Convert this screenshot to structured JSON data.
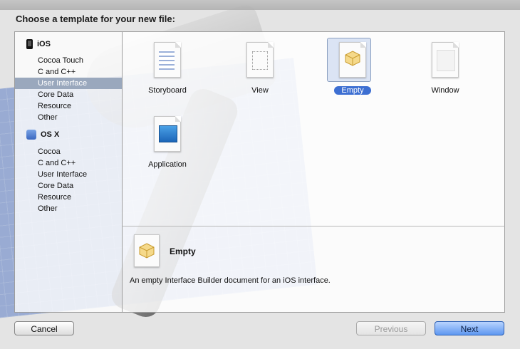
{
  "dialog": {
    "title": "Choose a template for your new file:"
  },
  "sidebar": {
    "sections": [
      {
        "name": "iOS",
        "items": [
          "Cocoa Touch",
          "C and C++",
          "User Interface",
          "Core Data",
          "Resource",
          "Other"
        ]
      },
      {
        "name": "OS X",
        "items": [
          "Cocoa",
          "C and C++",
          "User Interface",
          "Core Data",
          "Resource",
          "Other"
        ]
      }
    ],
    "selected": {
      "section": "iOS",
      "item": "User Interface"
    }
  },
  "templates": {
    "items": [
      {
        "name": "Storyboard",
        "icon": "storyboard-icon"
      },
      {
        "name": "View",
        "icon": "view-icon"
      },
      {
        "name": "Empty",
        "icon": "empty-interface-icon",
        "selected": true
      },
      {
        "name": "Window",
        "icon": "window-icon"
      },
      {
        "name": "Application",
        "icon": "application-icon"
      }
    ]
  },
  "detail": {
    "title": "Empty",
    "description": "An empty Interface Builder document for an iOS interface.",
    "icon": "empty-interface-icon"
  },
  "buttons": {
    "cancel": "Cancel",
    "previous": "Previous",
    "next": "Next"
  },
  "colors": {
    "selection": "#3d6fd2",
    "sidebar_selection": "#9aa8bd",
    "blueprint": "#5c7ec6"
  }
}
